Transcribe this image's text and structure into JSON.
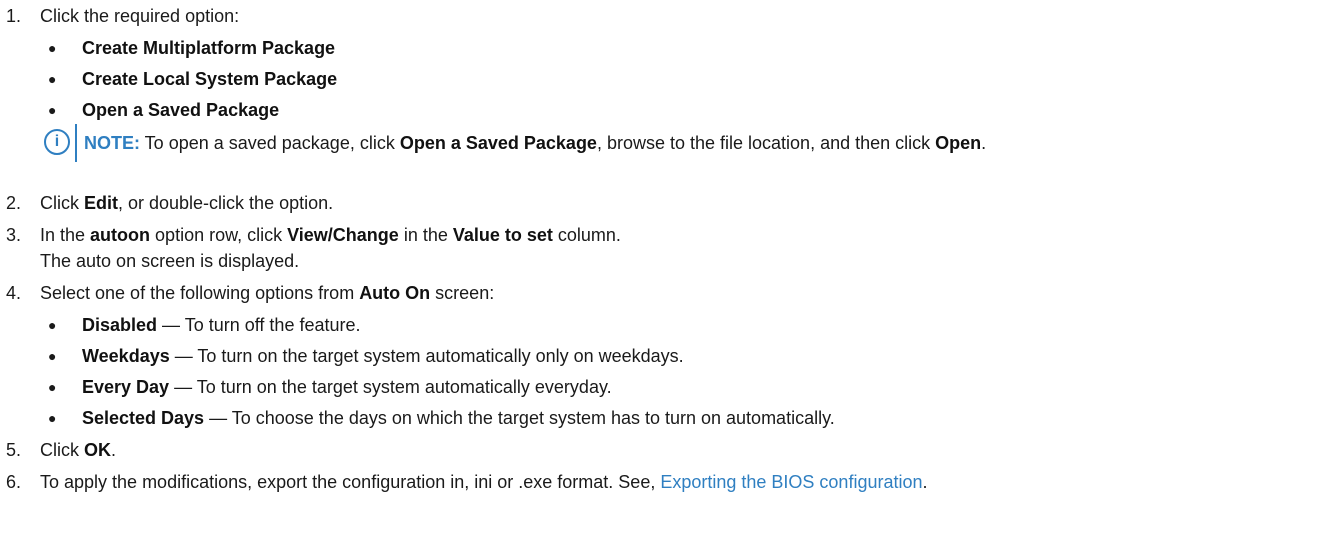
{
  "steps": [
    {
      "num": "1.",
      "text": "Click the required option:"
    },
    {
      "num": "2.",
      "pre": "Click ",
      "b1": "Edit",
      "post": ", or double-click the option."
    },
    {
      "num": "3.",
      "pre": "In the ",
      "b1": "autoon",
      "mid1": " option row, click ",
      "b2": "View/Change",
      "mid2": " in the ",
      "b3": "Value to set",
      "post": " column.",
      "line2": "The auto on screen is displayed."
    },
    {
      "num": "4.",
      "pre": "Select one of the following options from ",
      "b1": "Auto On",
      "post": " screen:"
    },
    {
      "num": "5.",
      "pre": "Click ",
      "b1": "OK",
      "post": "."
    },
    {
      "num": "6.",
      "pre": "To apply the modifications, export the configuration in, ini or .exe format. See, ",
      "link": "Exporting the BIOS configuration",
      "post": "."
    }
  ],
  "step1_options": [
    "Create Multiplatform Package",
    "Create Local System Package",
    "Open a Saved Package"
  ],
  "note": {
    "icon": "info-icon",
    "label": "NOTE:",
    "pre": " To open a saved package, click ",
    "b1": "Open a Saved Package",
    "mid": ", browse to the file location, and then click ",
    "b2": "Open",
    "post": "."
  },
  "step4_options": [
    {
      "name": "Disabled",
      "desc": " — To turn off the feature."
    },
    {
      "name": "Weekdays",
      "desc": " — To turn on the target system automatically only on weekdays."
    },
    {
      "name": "Every Day",
      "desc": " — To turn on the target system automatically everyday."
    },
    {
      "name": "Selected Days",
      "desc": " — To choose the days on which the target system has to turn on automatically."
    }
  ],
  "bullet_glyph": "●",
  "colors": {
    "accent": "#2f7fc1",
    "text": "#1a1a1a"
  }
}
